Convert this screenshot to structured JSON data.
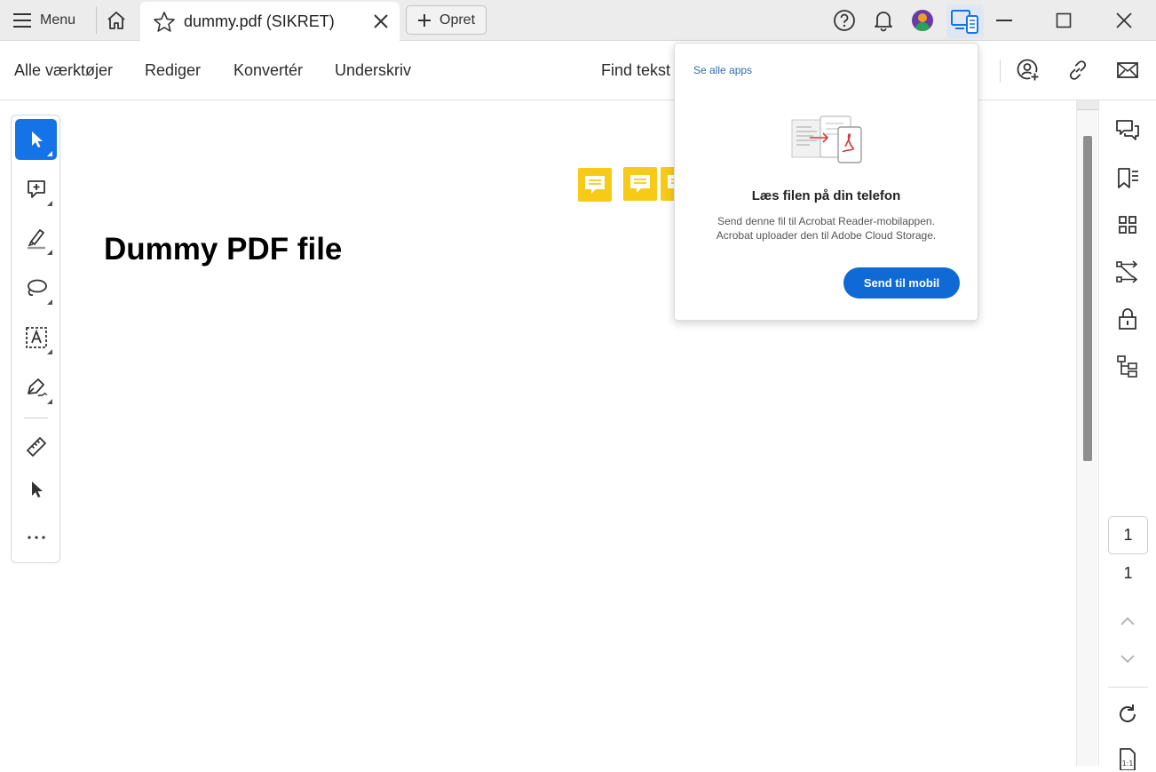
{
  "titlebar": {
    "menu_label": "Menu",
    "tab_title": "dummy.pdf (SIKRET)",
    "new_label": "Opret"
  },
  "toolbar": {
    "items": [
      "Alle værktøjer",
      "Rediger",
      "Konvertér",
      "Underskriv"
    ],
    "find_label": "Find tekst"
  },
  "document": {
    "title": "Dummy PDF file"
  },
  "popover": {
    "link": "Se alle apps",
    "heading": "Læs filen på din telefon",
    "body_line1": "Send denne fil til Acrobat Reader-mobilappen.",
    "body_line2": "Acrobat uploader den til Adobe Cloud Storage.",
    "button": "Send til mobil"
  },
  "page_nav": {
    "current": "1",
    "total": "1"
  },
  "colors": {
    "accent": "#1473e6",
    "button_blue": "#0f6ad6",
    "comment_yellow": "#f7ca18",
    "link_blue": "#2d6bb5"
  }
}
